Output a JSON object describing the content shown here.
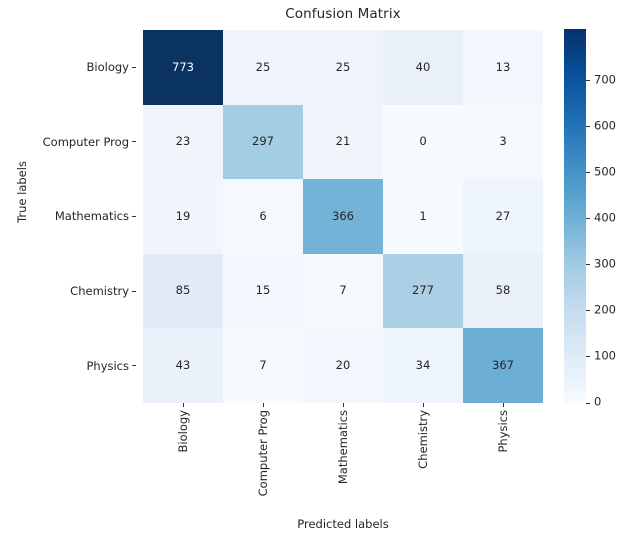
{
  "chart_data": {
    "type": "heatmap",
    "title": "Confusion Matrix",
    "xlabel": "Predicted labels",
    "ylabel": "True labels",
    "categories": [
      "Biology",
      "Computer Prog",
      "Mathematics",
      "Chemistry",
      "Physics"
    ],
    "row_labels": [
      "Biology",
      "Computer Prog",
      "Mathematics",
      "Chemistry",
      "Physics"
    ],
    "col_labels": [
      "Biology",
      "Computer Prog",
      "Mathematics",
      "Chemistry",
      "Physics"
    ],
    "matrix": [
      [
        773,
        25,
        25,
        40,
        13
      ],
      [
        23,
        297,
        21,
        0,
        3
      ],
      [
        19,
        6,
        366,
        1,
        27
      ],
      [
        85,
        15,
        7,
        277,
        58
      ],
      [
        43,
        7,
        20,
        34,
        367
      ]
    ],
    "cell_colors": [
      [
        "#0b3362",
        "#eff4fc",
        "#eff4fc",
        "#e9f0fa",
        "#f2f7fd"
      ],
      [
        "#f0f5fc",
        "#a2cde3",
        "#f0f5fc",
        "#f7fbff",
        "#f6fafe"
      ],
      [
        "#f1f6fd",
        "#f5f9fe",
        "#74b3d8",
        "#f6fafe",
        "#eef4fc"
      ],
      [
        "#e0ebf7",
        "#f3f8fe",
        "#f6fafe",
        "#accfe5",
        "#e9f0fa"
      ],
      [
        "#eaf1fb",
        "#f6fafe",
        "#f2f7fd",
        "#eef4fc",
        "#6daed5"
      ]
    ],
    "text_colors": [
      [
        "#ffffff",
        "#262626",
        "#262626",
        "#262626",
        "#262626"
      ],
      [
        "#262626",
        "#262626",
        "#262626",
        "#262626",
        "#262626"
      ],
      [
        "#262626",
        "#262626",
        "#262626",
        "#262626",
        "#262626"
      ],
      [
        "#262626",
        "#262626",
        "#262626",
        "#262626",
        "#262626"
      ],
      [
        "#262626",
        "#262626",
        "#262626",
        "#262626",
        "#262626"
      ]
    ],
    "colormap": "Blues",
    "colorbar": {
      "ticks": [
        0,
        100,
        200,
        300,
        400,
        500,
        600,
        700
      ],
      "tick_labels": [
        "0",
        "100",
        "200",
        "300",
        "400",
        "500",
        "600",
        "700"
      ],
      "vmin": 0,
      "vmax": 812,
      "gradient_stops": [
        "#f7fbff",
        "#deebf7",
        "#c6dbef",
        "#9ecae1",
        "#6baed6",
        "#4292c6",
        "#2171b5",
        "#08519c",
        "#08306b"
      ]
    },
    "grid": false,
    "legend_position": "right"
  }
}
